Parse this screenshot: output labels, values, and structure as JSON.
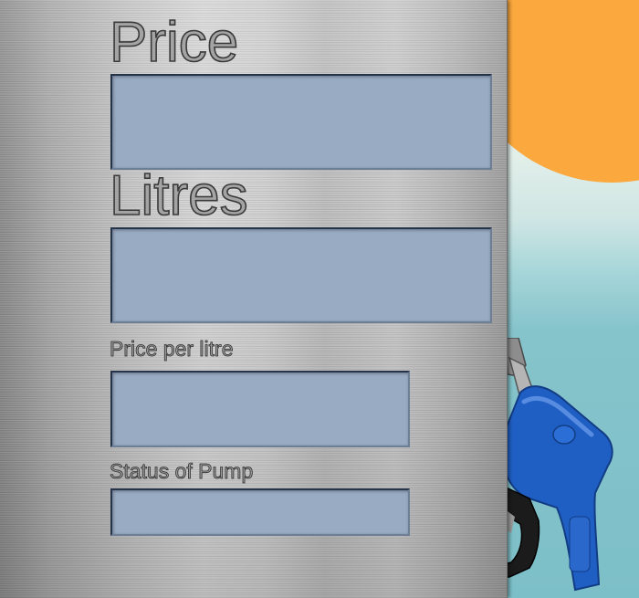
{
  "panel": {
    "price": {
      "label": "Price",
      "value": ""
    },
    "litres": {
      "label": "Litres",
      "value": ""
    },
    "price_per_litre": {
      "label": "Price per litre",
      "value": ""
    },
    "pump_status": {
      "label": "Status of Pump",
      "value": ""
    }
  },
  "scenery": {
    "sun_icon": "sun-icon",
    "nozzle_icon": "fuel-nozzle-icon"
  },
  "colors": {
    "field_fill": "#98abc2",
    "field_border": "#25344a",
    "sun": "#fba83e",
    "sky": "#7dbfc8",
    "nozzle": "#1f5fc4"
  }
}
